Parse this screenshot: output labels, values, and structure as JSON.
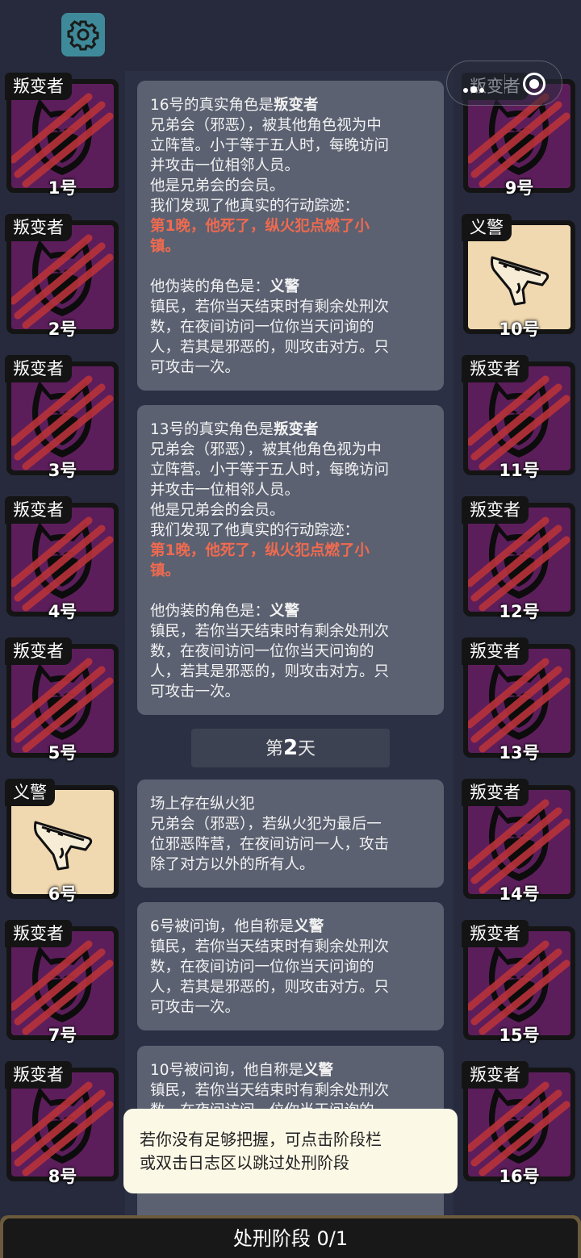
{
  "settings": {
    "icon": "gear-icon"
  },
  "capsule": {
    "menu_icon": "more-dots-icon",
    "close_icon": "target-circle-icon"
  },
  "left_players": [
    {
      "role": "叛变者",
      "num": "1号",
      "type": "traitor"
    },
    {
      "role": "叛变者",
      "num": "2号",
      "type": "traitor"
    },
    {
      "role": "叛变者",
      "num": "3号",
      "type": "traitor"
    },
    {
      "role": "叛变者",
      "num": "4号",
      "type": "traitor"
    },
    {
      "role": "叛变者",
      "num": "5号",
      "type": "traitor"
    },
    {
      "role": "义警",
      "num": "6号",
      "type": "vigilante"
    },
    {
      "role": "叛变者",
      "num": "7号",
      "type": "traitor"
    },
    {
      "role": "叛变者",
      "num": "8号",
      "type": "traitor"
    }
  ],
  "right_players": [
    {
      "role": "叛变者",
      "num": "9号",
      "type": "traitor"
    },
    {
      "role": "义警",
      "num": "10号",
      "type": "vigilante"
    },
    {
      "role": "叛变者",
      "num": "11号",
      "type": "traitor"
    },
    {
      "role": "叛变者",
      "num": "12号",
      "type": "traitor"
    },
    {
      "role": "叛变者",
      "num": "13号",
      "type": "traitor"
    },
    {
      "role": "叛变者",
      "num": "14号",
      "type": "traitor"
    },
    {
      "role": "叛变者",
      "num": "15号",
      "type": "traitor"
    },
    {
      "role": "叛变者",
      "num": "16号",
      "type": "traitor"
    }
  ],
  "log": {
    "msg1": {
      "title_pre": "16号的真实角色是",
      "title_role": "叛变者",
      "desc": [
        "兄弟会（邪恶），被其他角色视为中",
        "立阵营。小于等于五人时，每晚访问",
        "并攻击一位相邻人员。",
        "他是兄弟会的会员。",
        "我们发现了他真实的行动踪迹："
      ],
      "red": [
        "第1晚，他死了，纵火犯点燃了小",
        "镇。"
      ],
      "disguise_pre": "他伪装的角色是：",
      "disguise_role": "义警",
      "disguise_desc": [
        "镇民，若你当天结束时有剩余处刑次",
        "数，在夜间访问一位你当天问询的",
        "人，若其是邪恶的，则攻击对方。只",
        "可攻击一次。"
      ]
    },
    "msg2": {
      "title_pre": "13号的真实角色是",
      "title_role": "叛变者",
      "desc": [
        "兄弟会（邪恶），被其他角色视为中",
        "立阵营。小于等于五人时，每晚访问",
        "并攻击一位相邻人员。",
        "他是兄弟会的会员。",
        "我们发现了他真实的行动踪迹："
      ],
      "red": [
        "第1晚，他死了，纵火犯点燃了小",
        "镇。"
      ],
      "disguise_pre": "他伪装的角色是：",
      "disguise_role": "义警",
      "disguise_desc": [
        "镇民，若你当天结束时有剩余处刑次",
        "数，在夜间访问一位你当天问询的",
        "人，若其是邪恶的，则攻击对方。只",
        "可攻击一次。"
      ]
    },
    "day": {
      "pre": "第",
      "num": "2",
      "post": "天"
    },
    "msg3": {
      "lines": [
        "场上存在纵火犯",
        "兄弟会（邪恶），若纵火犯为最后一",
        "位邪恶阵营，在夜间访问一人，攻击",
        "除了对方以外的所有人。"
      ]
    },
    "msg4": {
      "title_pre": "6号被问询，他自称是",
      "title_role": "义警",
      "desc": [
        "镇民，若你当天结束时有剩余处刑次",
        "数，在夜间访问一位你当天问询的",
        "人，若其是邪恶的，则攻击对方。只",
        "可攻击一次。"
      ]
    },
    "msg5": {
      "title_pre": "10号被问询，他自称是",
      "title_role": "义警",
      "desc": [
        "镇民，若你当天结束时有剩余处刑次",
        "数，在夜间访问一位你当天问询的"
      ]
    }
  },
  "toast": {
    "lines": [
      "若你没有足够把握，可点击阶段栏",
      "或双击日志区以跳过处刑阶段"
    ]
  },
  "phase_bar": {
    "label": "处刑阶段 0/1"
  },
  "colors": {
    "background": "#262a3c",
    "traitor_card": "#5c1e5b",
    "vigilante_card": "#f0d8b0",
    "highlight_red": "#f06a4f",
    "bubble": "#5b6171"
  }
}
